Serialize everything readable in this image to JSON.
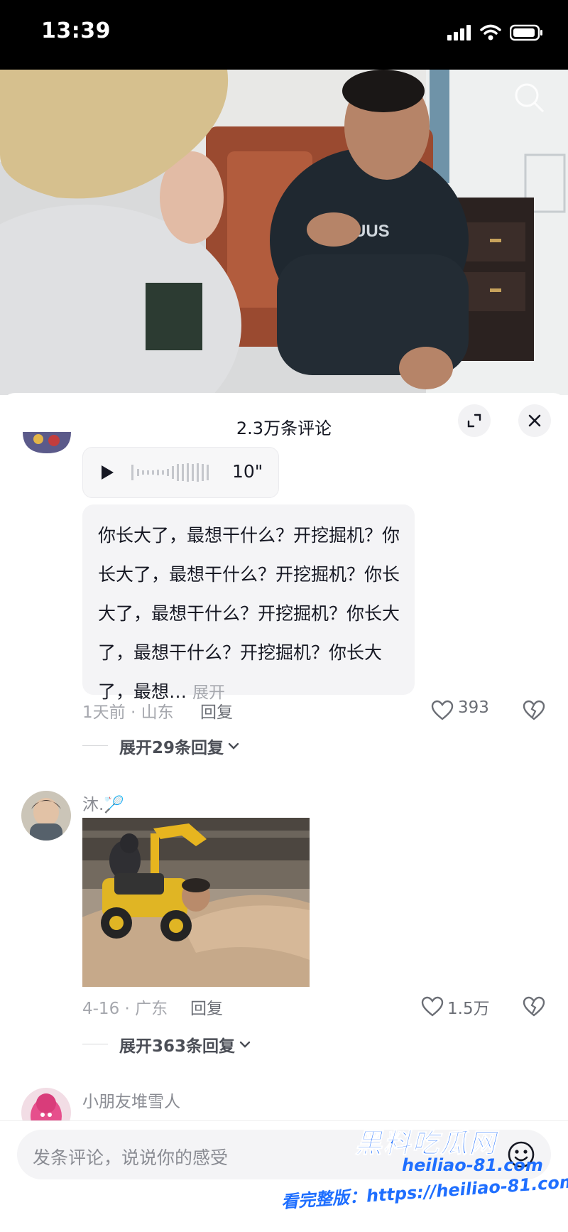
{
  "status_bar": {
    "time": "13:39"
  },
  "comments_panel": {
    "title": "2.3万条评论",
    "comments": [
      {
        "voice_duration": "10\"",
        "text": "你长大了，最想干什么？开挖掘机？你长大了，最想干什么？开挖掘机？你长大了，最想干什么？开挖掘机？你长大了，最想干什么？开挖掘机？你长大了，最想…",
        "expand_label": "展开",
        "meta": "1天前 · 山东",
        "reply_label": "回复",
        "likes": "393",
        "replies_label": "展开29条回复"
      },
      {
        "username": "沐.🏸",
        "meta": "4-16 · 广东",
        "reply_label": "回复",
        "likes": "1.5万",
        "replies_label": "展开363条回复"
      },
      {
        "username": "小朋友堆雪人"
      }
    ]
  },
  "composer": {
    "placeholder": "发条评论，说说你的感受"
  },
  "watermark": {
    "brand": "黑料吃瓜网",
    "domain": "heiliao-81.com",
    "link_text": "看完整版：https://heiliao-81.com"
  },
  "colors": {
    "accent_blue": "#1f6fff",
    "text": "#161823",
    "muted": "#a5a7ad"
  }
}
